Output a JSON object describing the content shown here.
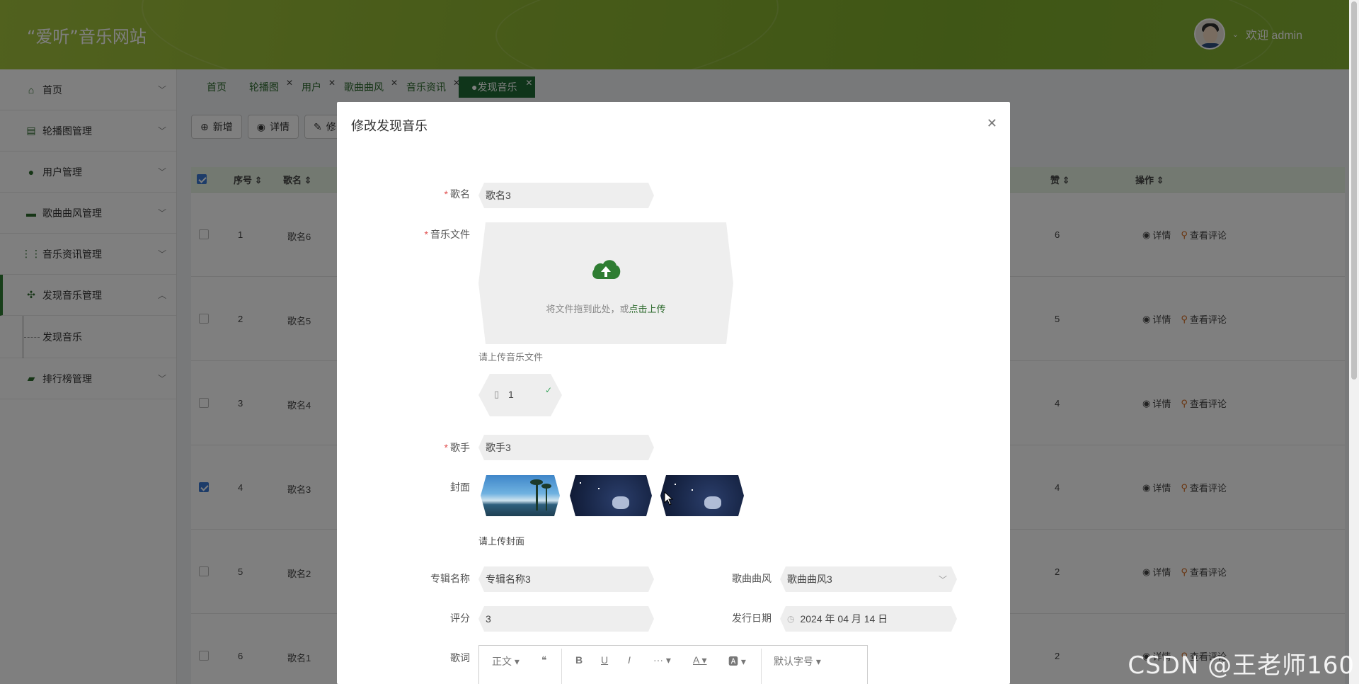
{
  "header": {
    "site_title": "“爱听”音乐网站",
    "welcome": "欢迎 admin"
  },
  "sidebar": {
    "items": [
      {
        "label": "首页",
        "icon": "home-icon"
      },
      {
        "label": "轮播图管理",
        "icon": "carousel-icon"
      },
      {
        "label": "用户管理",
        "icon": "user-icon"
      },
      {
        "label": "歌曲曲风管理",
        "icon": "style-icon"
      },
      {
        "label": "音乐资讯管理",
        "icon": "grid-icon"
      },
      {
        "label": "发现音乐管理",
        "icon": "apps-icon"
      },
      {
        "label": "排行榜管理",
        "icon": "ranking-icon"
      }
    ],
    "sub_item": "发现音乐"
  },
  "tabs": [
    {
      "label": "首页"
    },
    {
      "label": "轮播图"
    },
    {
      "label": "用户"
    },
    {
      "label": "歌曲曲风"
    },
    {
      "label": "音乐资讯"
    },
    {
      "label": "●发现音乐"
    }
  ],
  "toolbar": {
    "add_label": "新增",
    "detail_label": "详情",
    "edit_label": "修"
  },
  "table": {
    "headers": [
      "序号",
      "歌名",
      "赞",
      "操作"
    ],
    "rows": [
      {
        "index": "1",
        "name": "歌名6",
        "likes": "6",
        "checked": false
      },
      {
        "index": "2",
        "name": "歌名5",
        "likes": "5",
        "checked": false
      },
      {
        "index": "3",
        "name": "歌名4",
        "likes": "4",
        "checked": false
      },
      {
        "index": "4",
        "name": "歌名3",
        "likes": "4",
        "checked": true
      },
      {
        "index": "5",
        "name": "歌名2",
        "likes": "2",
        "checked": false
      },
      {
        "index": "6",
        "name": "歌名1",
        "likes": "2",
        "checked": false
      }
    ],
    "action_detail": "详情",
    "action_comment": "查看评论"
  },
  "dialog": {
    "title": "修改发现音乐",
    "song_label": "歌名",
    "song_value": "歌名3",
    "file_label": "音乐文件",
    "upload_text": "将文件拖到此处，或",
    "upload_link": "点击上传",
    "upload_hint": "请上传音乐文件",
    "file_name": "1",
    "singer_label": "歌手",
    "singer_value": "歌手3",
    "cover_label": "封面",
    "cover_hint": "请上传封面",
    "album_label": "专辑名称",
    "album_value": "专辑名称3",
    "style_label": "歌曲曲风",
    "style_value": "歌曲曲风3",
    "rating_label": "评分",
    "rating_value": "3",
    "date_label": "发行日期",
    "date_value": "2024 年 04 月 14 日",
    "lyrics_label": "歌词",
    "editor": {
      "format": "正文",
      "font_size": "默认字号"
    }
  },
  "watermark": "CSDN @王老师160",
  "colors": {
    "accent": "#2d6a2d",
    "active_tab": "#1e6b35",
    "header": "#8eb532"
  }
}
